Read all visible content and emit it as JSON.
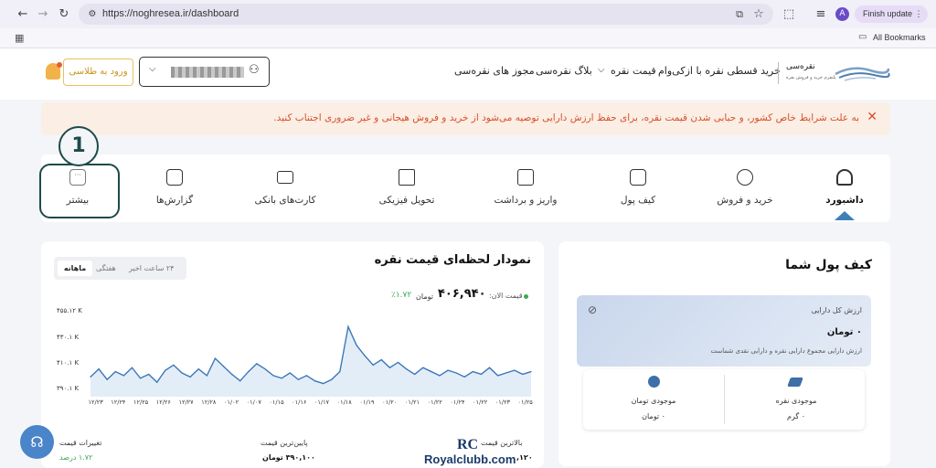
{
  "browser": {
    "url": "https://noghresea.ir/dashboard",
    "profile_initial": "A",
    "update_label": "Finish update",
    "all_bookmarks": "All Bookmarks"
  },
  "header": {
    "login_label": "ورود به طلاسی",
    "nav": [
      "خرید قسطی نقره با ازکی‌وام",
      "قیمت نقره",
      "بلاگ نقره‌سی",
      "مجوز های نقره‌سی"
    ],
    "logo_text": "نقره‌سی",
    "logo_sub": "پلتفرم خرید و فروش نقره"
  },
  "banner": {
    "text": "به علت شرایط خاص کشور، و حبابی شدن قیمت نقره، برای حفظ ارزش دارایی توصیه می‌شود از خرید و فروش هیجانی و غیر ضروری اجتناب کنید."
  },
  "tabs": [
    {
      "label": "داشبورد",
      "icon": "home-icon",
      "active": true
    },
    {
      "label": "خرید و فروش",
      "icon": "exchange-icon"
    },
    {
      "label": "کیف پول",
      "icon": "wallet-icon"
    },
    {
      "label": "واریز و برداشت",
      "icon": "deposit-icon"
    },
    {
      "label": "تحویل فیزیکی",
      "icon": "store-icon"
    },
    {
      "label": "کارت‌های بانکی",
      "icon": "card-icon"
    },
    {
      "label": "گزارش‌ها",
      "icon": "chart-icon"
    },
    {
      "label": "بیشتر",
      "icon": "more-icon"
    }
  ],
  "annotation_number": "1",
  "wallet": {
    "title": "کیف پول شما",
    "total_label": "ارزش کل دارایی",
    "total_value": "۰ تومان",
    "desc": "ارزش دارایی مجموع دارایی نقره و دارایی نقدی شماست",
    "silver_label": "موجودی نقره",
    "silver_value": "۰ گرم",
    "toman_label": "موجودی تومان",
    "toman_value": "۰ تومان"
  },
  "price_chart": {
    "title": "نمودار لحظه‌ای قیمت نقره",
    "periods": [
      "ماهانه",
      "هفتگی",
      "۲۴ ساعت اخیر"
    ],
    "current_label": "قیمت الان:",
    "current_value": "۴۰۶,۹۴۰",
    "current_unit": "تومان",
    "change": "٪۱.۷۲",
    "highest_label": "بالاترین قیمت",
    "highest_value": "۱۲۰,",
    "lowest_label": "پایین‌ترین قیمت",
    "lowest_value": "۳۹۰,۱۰۰ تومان",
    "change_label": "تغییرات قیمت",
    "change_value": "۱.۷۲ درصد"
  },
  "chart_data": {
    "type": "line",
    "yticks": [
      "۴۵۵.۱۲ K",
      "۴۳۰.۱ K",
      "۴۱۰.۱ K",
      "۳۹۰.۱ K"
    ],
    "ylim": [
      390.1,
      455.12
    ],
    "xticks": [
      "۱۲/۲۳",
      "۱۲/۲۴",
      "۱۲/۲۵",
      "۱۲/۲۶",
      "۱۲/۲۷",
      "۱۲/۲۸",
      "۰۱/۰۲",
      "۰۱/۰۷",
      "۰۱/۱۵",
      "۰۱/۱۶",
      "۰۱/۱۷",
      "۰۱/۱۸",
      "۰۱/۱۹",
      "۰۱/۲۰",
      "۰۱/۲۱",
      "۰۱/۲۲",
      "۰۱/۲۴",
      "۰۱/۲۲",
      "۰۱/۲۳",
      "۰۱/۲۵"
    ],
    "values": [
      403,
      409,
      401,
      407,
      404,
      410,
      402,
      405,
      399,
      408,
      412,
      406,
      403,
      409,
      404,
      417,
      411,
      405,
      400,
      407,
      413,
      409,
      404,
      402,
      406,
      401,
      404,
      400,
      398,
      401,
      407,
      441,
      427,
      419,
      412,
      416,
      410,
      414,
      409,
      405,
      410,
      407,
      404,
      408,
      406,
      403,
      407,
      405,
      410,
      404,
      406,
      408,
      405,
      407
    ]
  },
  "watermark": {
    "logo": "RC",
    "text": "Royalclubb.com"
  }
}
